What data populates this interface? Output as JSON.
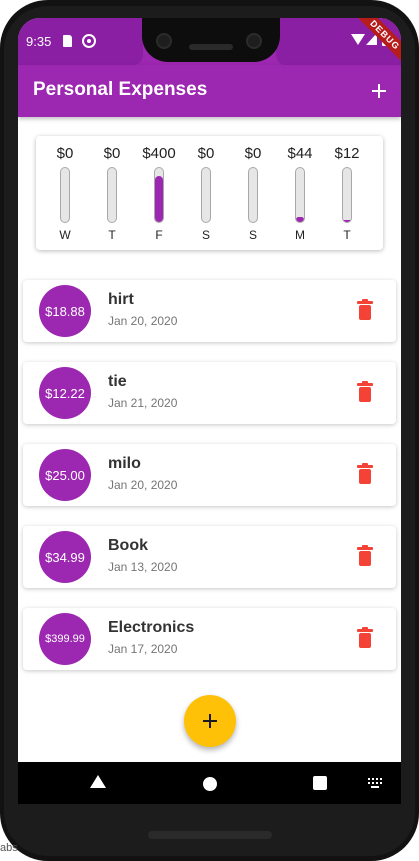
{
  "status_bar": {
    "time": "9:35",
    "debug_label": "DEBUG"
  },
  "app_bar": {
    "title": "Personal Expenses",
    "add_icon": "plus-icon"
  },
  "colors": {
    "primary": "#9c27b0",
    "accent": "#ffc107",
    "delete": "#f44336"
  },
  "chart": {
    "days": [
      {
        "amount": "$0",
        "day": "W",
        "share": 0
      },
      {
        "amount": "$0",
        "day": "T",
        "share": 0
      },
      {
        "amount": "$400",
        "day": "F",
        "share": 0.86
      },
      {
        "amount": "$0",
        "day": "S",
        "share": 0
      },
      {
        "amount": "$0",
        "day": "S",
        "share": 0
      },
      {
        "amount": "$44",
        "day": "M",
        "share": 0.09
      },
      {
        "amount": "$12",
        "day": "T",
        "share": 0.03
      }
    ]
  },
  "transactions": [
    {
      "amount": "$18.88",
      "title": "hirt",
      "date": "Jan 20, 2020",
      "delete_icon": "trash-icon"
    },
    {
      "amount": "$12.22",
      "title": "tie",
      "date": "Jan 21, 2020",
      "delete_icon": "trash-icon"
    },
    {
      "amount": "$25.00",
      "title": "milo",
      "date": "Jan 20, 2020",
      "delete_icon": "trash-icon"
    },
    {
      "amount": "$34.99",
      "title": "Book",
      "date": "Jan 13, 2020",
      "delete_icon": "trash-icon"
    },
    {
      "amount": "$399.99",
      "title": "Electronics",
      "date": "Jan 17, 2020",
      "delete_icon": "trash-icon"
    }
  ],
  "fab": {
    "icon": "plus-icon"
  },
  "nav_bar": {
    "icons": [
      "back-icon",
      "home-icon",
      "recents-icon",
      "keyboard-icon"
    ]
  },
  "background_text": "abs"
}
